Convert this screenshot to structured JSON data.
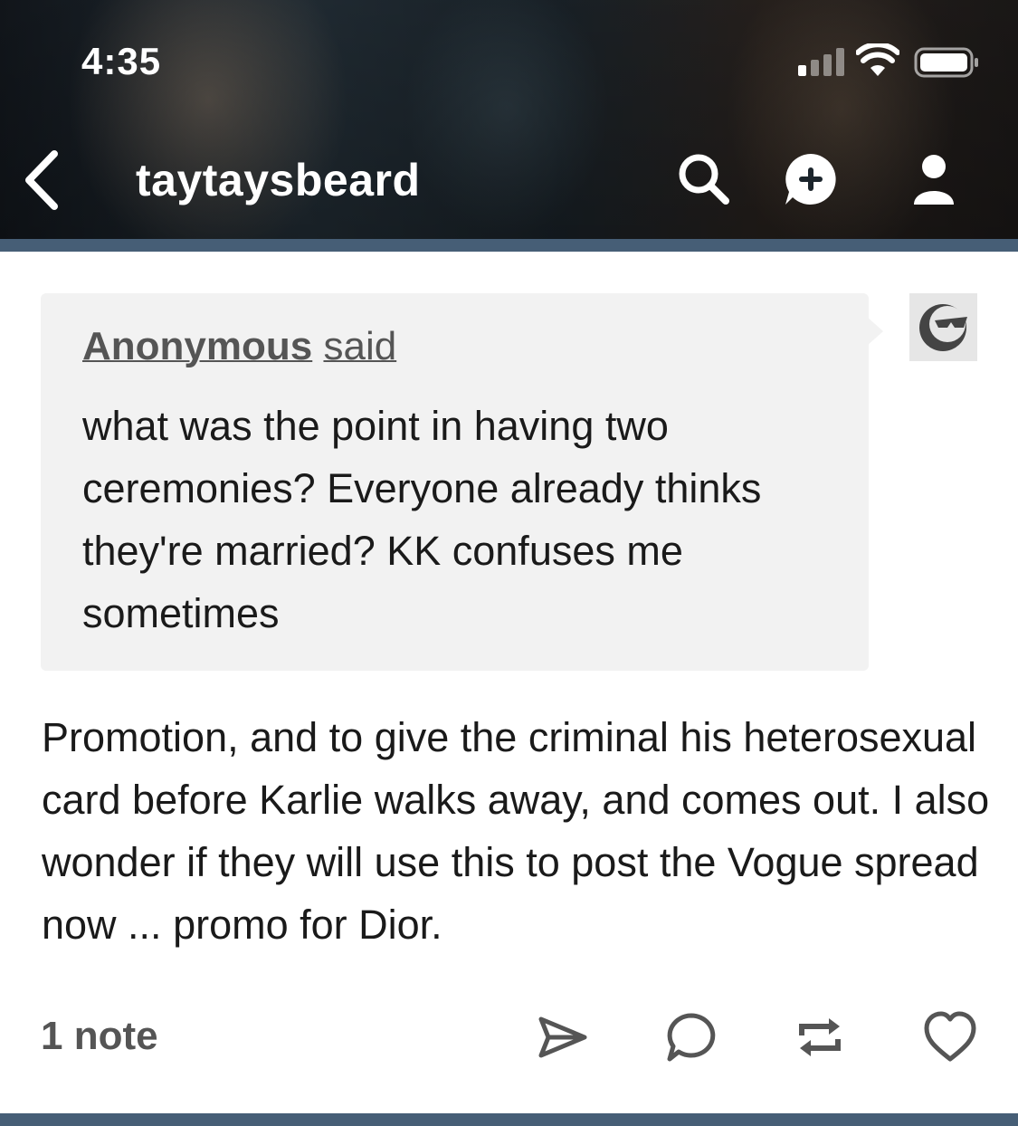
{
  "status_bar": {
    "time": "4:35",
    "icons": [
      "signal-icon",
      "wifi-icon",
      "battery-icon"
    ]
  },
  "header": {
    "blog_name": "taytaysbeard",
    "icons": [
      "back-icon",
      "search-icon",
      "new-post-icon",
      "account-icon"
    ]
  },
  "post": {
    "ask": {
      "asker": "Anonymous",
      "said": "said",
      "question": "what was the point in having two ceremonies? Everyone already thinks they're married? KK confuses me sometimes"
    },
    "answer": "Promotion, and to give the criminal his heterosexual card before Karlie walks away, and comes out. I also wonder if they will use this to post the Vogue spread now ... promo for Dior.",
    "notes": "1 note",
    "actions": [
      "share-icon",
      "reply-icon",
      "reblog-icon",
      "like-icon"
    ]
  },
  "colors": {
    "accent_bar": "#465e76",
    "ask_background": "#f2f2f2",
    "text": "#1a1a1a",
    "muted_text": "#555555"
  }
}
